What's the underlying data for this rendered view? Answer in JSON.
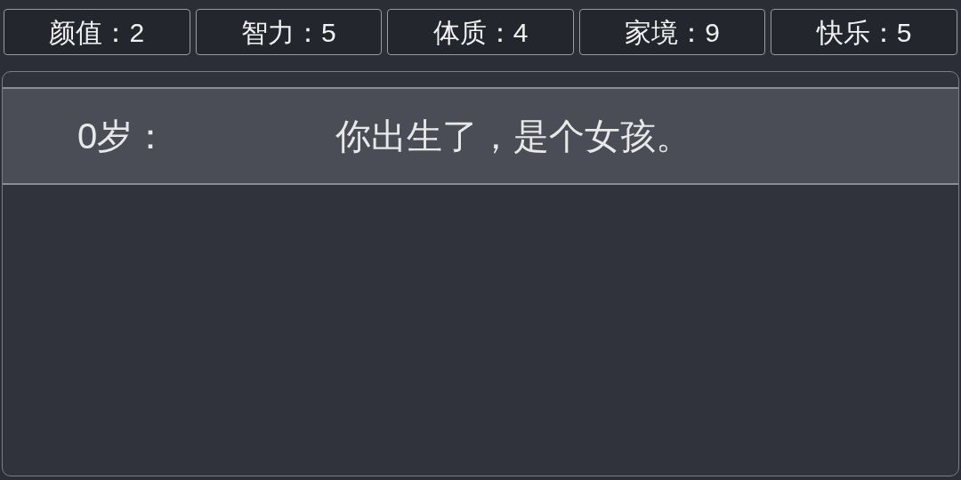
{
  "stats": [
    "颜值：2",
    "智力：5",
    "体质：4",
    "家境：9",
    "快乐：5"
  ],
  "events": [
    {
      "age": "0岁：",
      "text": "你出生了，是个女孩。"
    }
  ]
}
